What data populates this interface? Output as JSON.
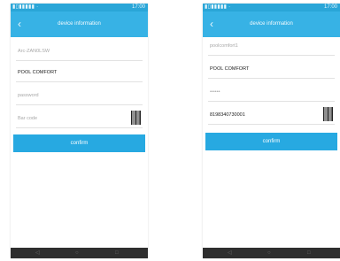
{
  "screens": [
    {
      "status_bar": {
        "icons": "▮▯▮▮▮▮▮ ·",
        "time": "17:00"
      },
      "title": "device information",
      "back_icon": "chevron-left-icon",
      "fields": [
        {
          "value": "",
          "placeholder": "Arc-ZAN0LSW",
          "filled": false,
          "barcode": false
        },
        {
          "value": "POOL COMFORT",
          "placeholder": "",
          "filled": true,
          "barcode": false
        },
        {
          "value": "",
          "placeholder": "password",
          "filled": false,
          "barcode": false
        },
        {
          "value": "",
          "placeholder": "Bar code",
          "filled": false,
          "barcode": true
        }
      ],
      "confirm_label": "confirm"
    },
    {
      "status_bar": {
        "icons": "▮▯▮▮▮▮▮ ·",
        "time": "17:00"
      },
      "title": "device information",
      "back_icon": "chevron-left-icon",
      "fields": [
        {
          "value": "",
          "placeholder": "poolcomfort1",
          "filled": false,
          "barcode": false
        },
        {
          "value": "POOL COMFORT",
          "placeholder": "",
          "filled": true,
          "barcode": false
        },
        {
          "value": "••••••",
          "placeholder": "",
          "filled": true,
          "barcode": false
        },
        {
          "value": "8198340730001",
          "placeholder": "",
          "filled": true,
          "barcode": true
        }
      ],
      "confirm_label": "confirm"
    }
  ],
  "colors": {
    "accent": "#37b2e5",
    "button": "#27a9e1",
    "status": "#2aa6d8",
    "nav": "#2e2e2e"
  },
  "nav_icons": [
    "back-icon",
    "home-icon",
    "recent-apps-icon"
  ]
}
